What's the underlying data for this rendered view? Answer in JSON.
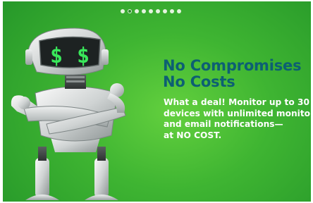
{
  "carousel": {
    "dot_count": 9,
    "active_index": 1
  },
  "slide": {
    "title_lines": [
      "No Compromises",
      "No Costs"
    ],
    "body_lines": [
      "What a deal!  Monitor up to 30",
      "devices with unlimited monitors",
      "and email notifications—",
      "at NO COST."
    ],
    "robot_face_glyphs": [
      "$",
      "$"
    ],
    "colors": {
      "background": "#3fb532",
      "title": "#0d5f73",
      "body_text": "#ffffff",
      "face_glyph": "#39e85a"
    }
  }
}
